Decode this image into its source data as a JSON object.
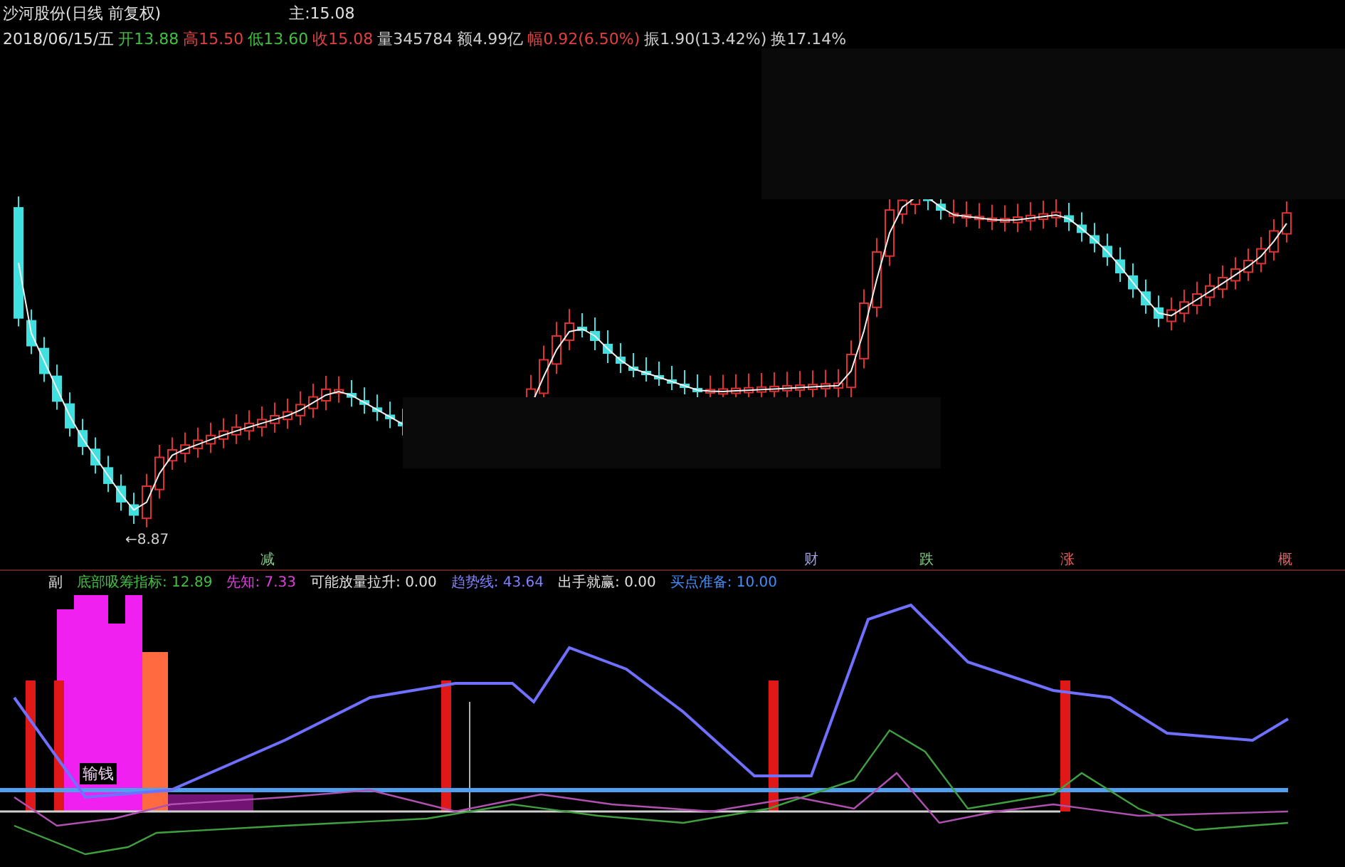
{
  "header": {
    "title": "沙河股份(日线 前复权)",
    "main_label": "主",
    "main_value": ":15.08",
    "date": "2018/06/15/五",
    "quotes": [
      {
        "label": "开",
        "value": "13.88",
        "color": "#40c040"
      },
      {
        "label": "高",
        "value": "15.50",
        "color": "#e04040"
      },
      {
        "label": "低",
        "value": "13.60",
        "color": "#40c040"
      },
      {
        "label": "收",
        "value": "15.08",
        "color": "#e04040"
      },
      {
        "label": "量",
        "value": "345784",
        "color": "#d0d0d0"
      },
      {
        "label": "额",
        "value": "4.99亿",
        "color": "#d0d0d0"
      },
      {
        "label": "幅",
        "value": "0.92(6.50%)",
        "color": "#e04040"
      },
      {
        "label": "振",
        "value": "1.90(13.42%)",
        "color": "#d0d0d0"
      },
      {
        "label": "换",
        "value": "17.14%",
        "color": "#d0d0d0"
      }
    ]
  },
  "price_chart": {
    "low_marker": "←8.87"
  },
  "event_labels": [
    {
      "text": "减",
      "color": "#80d080"
    },
    {
      "text": "财",
      "color": "#a0a0e0"
    },
    {
      "text": "跌",
      "color": "#80d080"
    },
    {
      "text": "涨",
      "color": "#e06060"
    },
    {
      "text": "概",
      "color": "#e06060"
    }
  ],
  "indicator_bar": {
    "pane": "副",
    "items": [
      {
        "label": "底部吸筹指标:",
        "value": "12.89",
        "color": "#40c040"
      },
      {
        "label": "先知:",
        "value": "7.33",
        "color": "#e040e0"
      },
      {
        "label": "可能放量拉升:",
        "value": "0.00",
        "color": "#e0e0e0"
      },
      {
        "label": "趋势线:",
        "value": "43.64",
        "color": "#8080ff"
      },
      {
        "label": "出手就赢:",
        "value": "0.00",
        "color": "#e0e0e0"
      },
      {
        "label": "买点准备:",
        "value": "10.00",
        "color": "#4090ff"
      }
    ]
  },
  "indicator_chart": {
    "line_label": "输钱"
  }
}
